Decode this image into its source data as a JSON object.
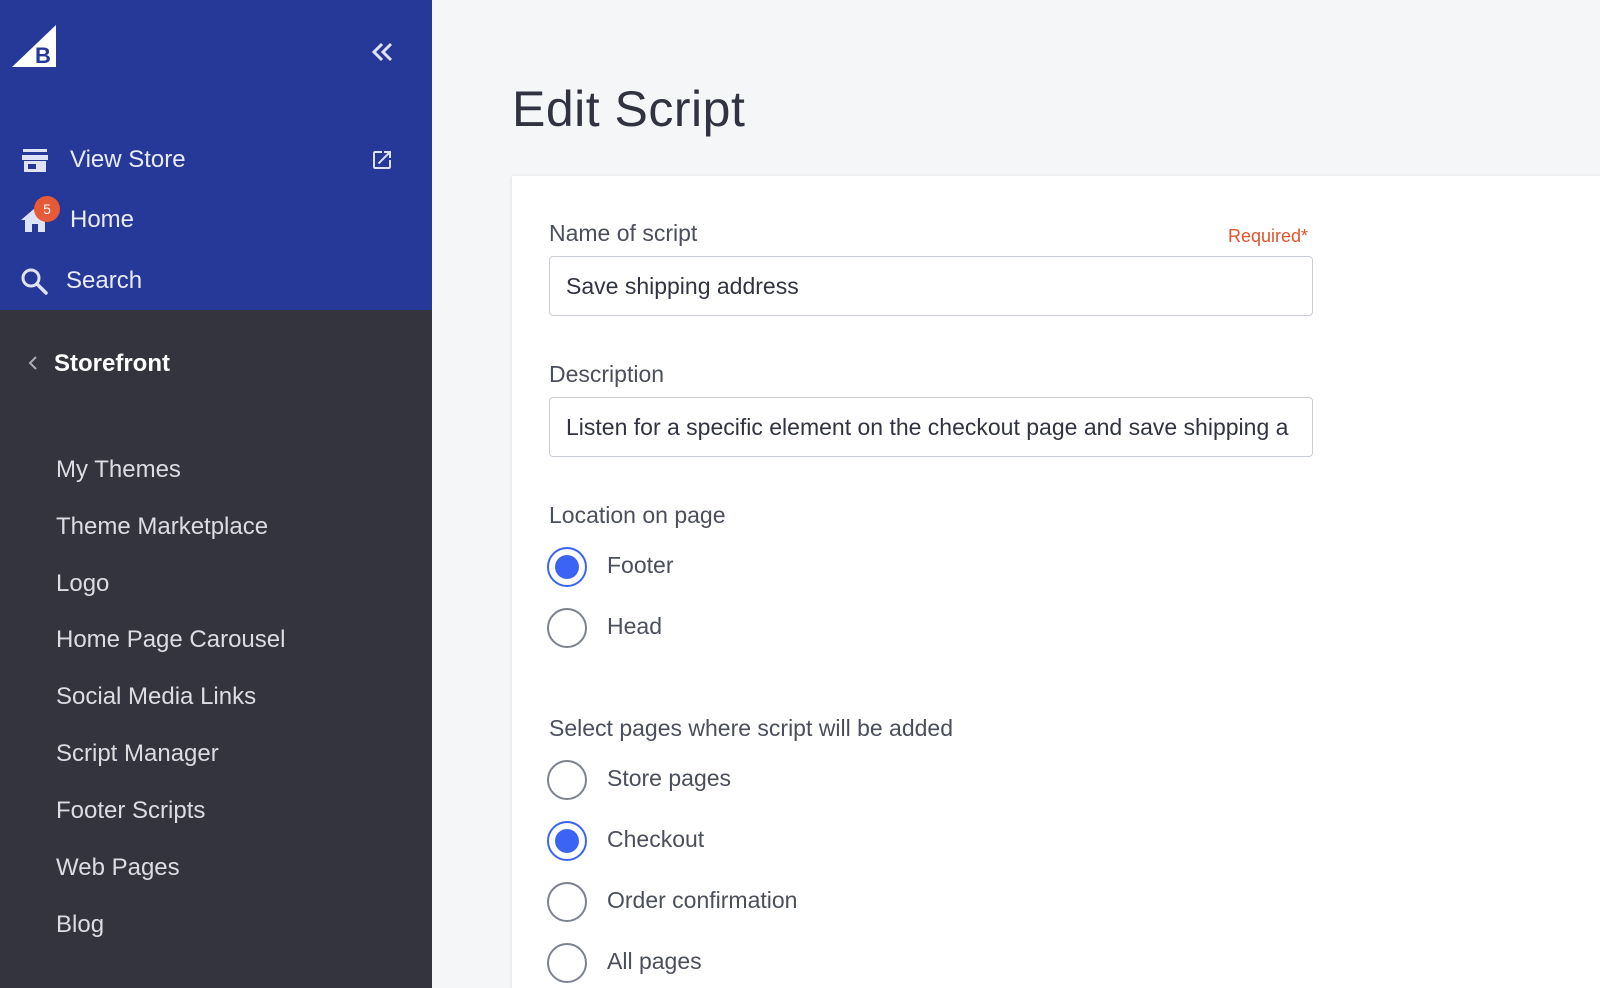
{
  "sidebar": {
    "top_items": [
      {
        "label": "View Store"
      },
      {
        "label": "Home",
        "badge": "5"
      },
      {
        "label": "Search"
      }
    ],
    "section": {
      "label": "Storefront"
    },
    "sub_items": [
      {
        "label": "My Themes"
      },
      {
        "label": "Theme Marketplace"
      },
      {
        "label": "Logo"
      },
      {
        "label": "Home Page Carousel"
      },
      {
        "label": "Social Media Links"
      },
      {
        "label": "Script Manager"
      },
      {
        "label": "Footer Scripts"
      },
      {
        "label": "Web Pages"
      },
      {
        "label": "Blog"
      }
    ],
    "colors": {
      "top_bg": "#263898",
      "bottom_bg": "#34343f"
    }
  },
  "page": {
    "title": "Edit Script"
  },
  "form": {
    "name": {
      "label": "Name of script",
      "required": "Required*",
      "value": "Save shipping address"
    },
    "description": {
      "label": "Description",
      "value": "Listen for a specific element on the checkout page and save shipping a"
    },
    "location": {
      "label": "Location on page",
      "options": [
        {
          "label": "Footer",
          "checked": true
        },
        {
          "label": "Head",
          "checked": false
        }
      ]
    },
    "pages": {
      "label": "Select pages where script will be added",
      "options": [
        {
          "label": "Store pages",
          "checked": false
        },
        {
          "label": "Checkout",
          "checked": true
        },
        {
          "label": "Order confirmation",
          "checked": false
        },
        {
          "label": "All pages",
          "checked": false
        }
      ]
    }
  },
  "accent_color": "#3c64f4"
}
